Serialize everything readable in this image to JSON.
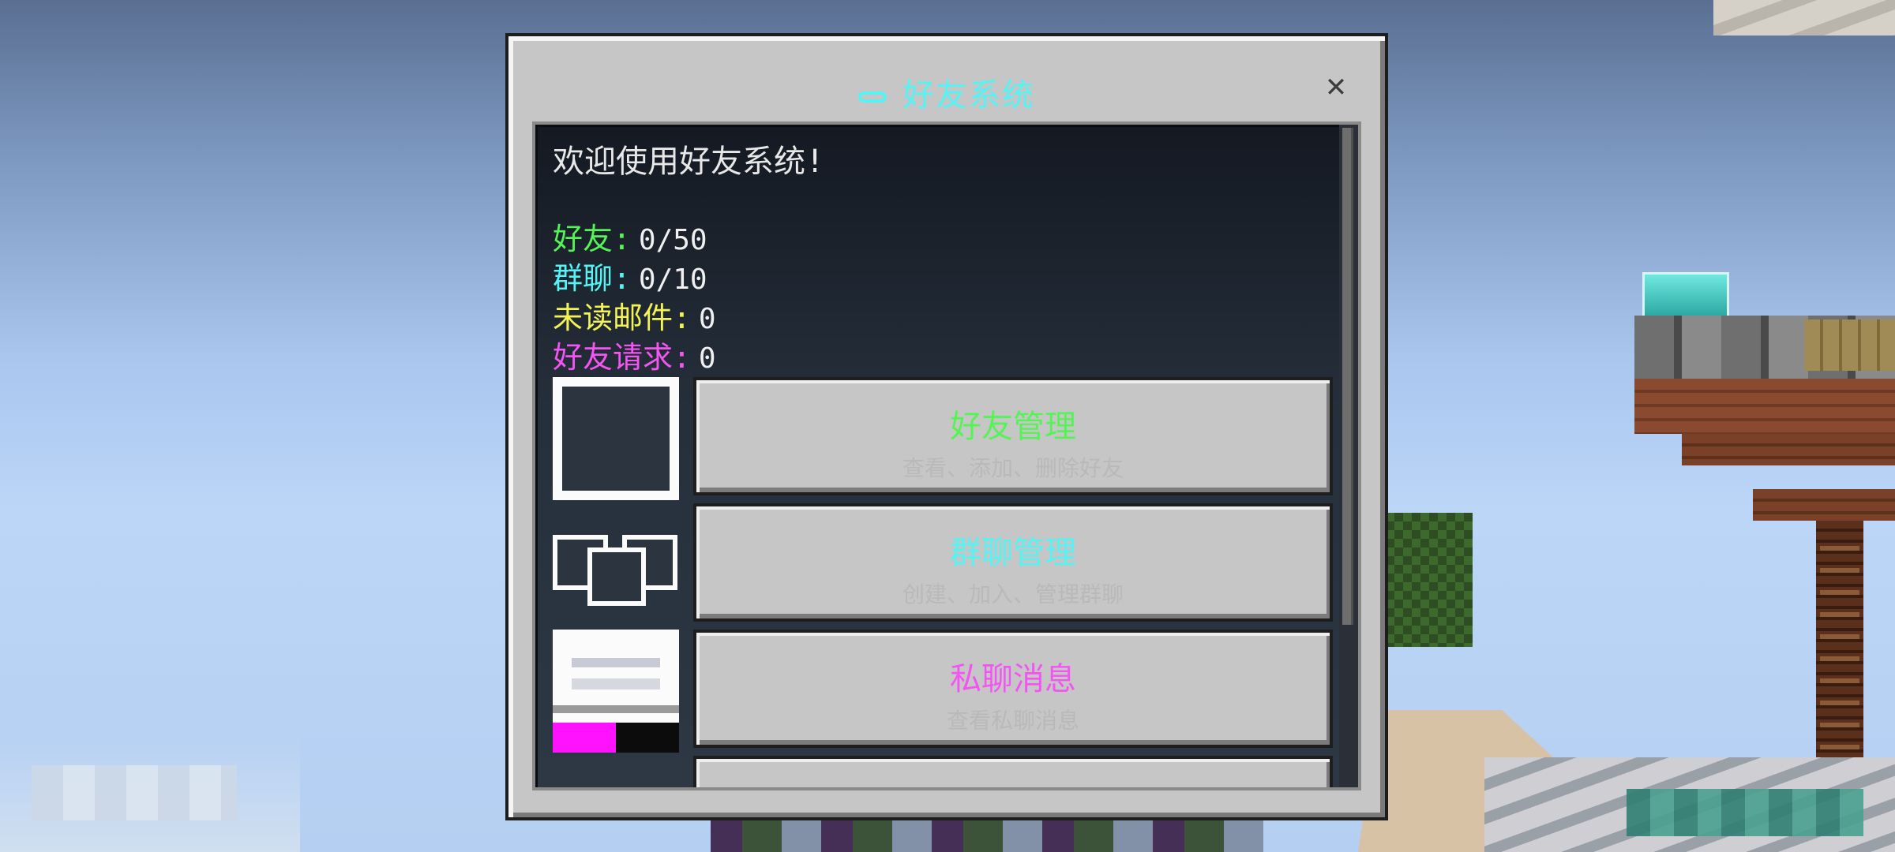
{
  "window": {
    "title": "好友系统"
  },
  "welcome": "欢迎使用好友系统!",
  "stats": [
    {
      "label": "好友:",
      "value": "0/50",
      "color": "#55f355"
    },
    {
      "label": "群聊:",
      "value": "0/10",
      "color": "#55f3f3"
    },
    {
      "label": "未读邮件:",
      "value": "0",
      "color": "#f3f355"
    },
    {
      "label": "好友请求:",
      "value": "0",
      "color": "#f355f3"
    }
  ],
  "menu": [
    {
      "title": "好友管理",
      "subtitle": "查看、添加、删除好友",
      "color": "#55f355",
      "icon": "friend-icon"
    },
    {
      "title": "群聊管理",
      "subtitle": "创建、加入、管理群聊",
      "color": "#55f3f3",
      "icon": "group-icon"
    },
    {
      "title": "私聊消息",
      "subtitle": "查看私聊消息",
      "color": "#f355f3",
      "icon": "mail-icon"
    }
  ],
  "icons": {
    "close": "close-icon",
    "title_glyph": "link-icon"
  }
}
